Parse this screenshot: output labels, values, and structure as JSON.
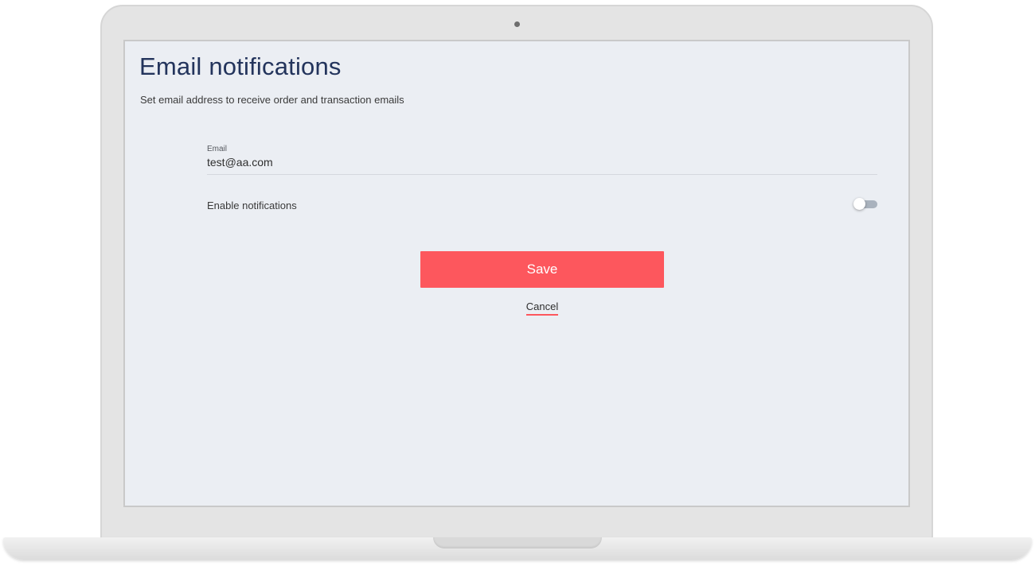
{
  "page": {
    "title": "Email notifications",
    "subtitle": "Set email address to receive order and transaction emails"
  },
  "email_field": {
    "label": "Email",
    "value": "test@aa.com"
  },
  "notifications": {
    "label": "Enable notifications",
    "enabled": false
  },
  "actions": {
    "save_label": "Save",
    "cancel_label": "Cancel"
  },
  "colors": {
    "accent": "#fd575d",
    "title": "#23345c",
    "screen_background": "#ebeef3",
    "toggle_track": "#a9b2bd"
  }
}
